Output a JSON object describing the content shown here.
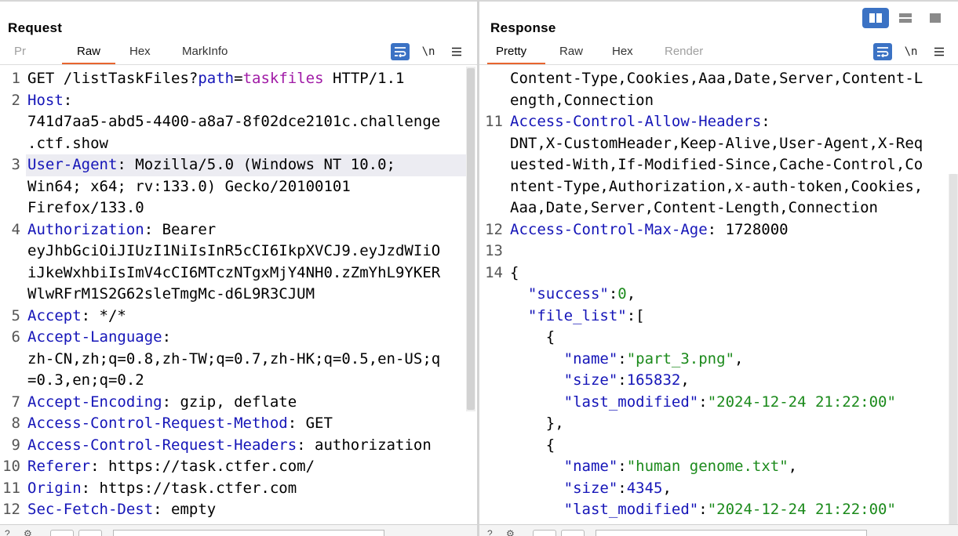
{
  "layout_buttons": [
    {
      "name": "split-vertical-icon",
      "active": true
    },
    {
      "name": "split-horizontal-icon",
      "active": false
    },
    {
      "name": "single-pane-icon",
      "active": false
    }
  ],
  "request": {
    "title": "Request",
    "tabs": [
      "Pr",
      "Raw",
      "Hex",
      "MarkInfo"
    ],
    "active_tab": "Raw",
    "toolbar": {
      "wrap_icon": "wrap-lines-icon",
      "newline_label": "\\n",
      "menu_icon": "menu-icon"
    },
    "lines": [
      {
        "num": "1",
        "parts": [
          [
            "t",
            "GET /listTaskFiles?"
          ],
          [
            "k",
            "path"
          ],
          [
            "t",
            "="
          ],
          [
            "p",
            "taskfiles"
          ],
          [
            "t",
            " HTTP/1.1"
          ]
        ]
      },
      {
        "num": "2",
        "parts": [
          [
            "k",
            "Host"
          ],
          [
            "t",
            ":"
          ]
        ]
      },
      {
        "num": "",
        "parts": [
          [
            "t",
            "741d7aa5-abd5-4400-a8a7-8f02dce2101c.challenge"
          ]
        ]
      },
      {
        "num": "",
        "parts": [
          [
            "t",
            ".ctf.show"
          ]
        ]
      },
      {
        "num": "3",
        "highlight": true,
        "parts": [
          [
            "k",
            "User-Agent"
          ],
          [
            "t",
            ": Mozilla/5.0 (Windows NT 10.0;"
          ]
        ]
      },
      {
        "num": "",
        "parts": [
          [
            "t",
            "Win64; x64; rv:133.0) Gecko/20100101"
          ]
        ]
      },
      {
        "num": "",
        "parts": [
          [
            "t",
            "Firefox/133.0"
          ]
        ]
      },
      {
        "num": "4",
        "parts": [
          [
            "k",
            "Authorization"
          ],
          [
            "t",
            ": Bearer"
          ]
        ]
      },
      {
        "num": "",
        "parts": [
          [
            "t",
            "eyJhbGciOiJIUzI1NiIsInR5cCI6IkpXVCJ9.eyJzdWIiO"
          ]
        ]
      },
      {
        "num": "",
        "parts": [
          [
            "t",
            "iJkeWxhbiIsImV4cCI6MTczNTgxMjY4NH0.zZmYhL9YKER"
          ]
        ]
      },
      {
        "num": "",
        "parts": [
          [
            "t",
            "WlwRFrM1S2G62sleTmgMc-d6L9R3CJUM"
          ]
        ]
      },
      {
        "num": "5",
        "parts": [
          [
            "k",
            "Accept"
          ],
          [
            "t",
            ": */*"
          ]
        ]
      },
      {
        "num": "6",
        "parts": [
          [
            "k",
            "Accept-Language"
          ],
          [
            "t",
            ":"
          ]
        ]
      },
      {
        "num": "",
        "parts": [
          [
            "t",
            "zh-CN,zh;q=0.8,zh-TW;q=0.7,zh-HK;q=0.5,en-US;q"
          ]
        ]
      },
      {
        "num": "",
        "parts": [
          [
            "t",
            "=0.3,en;q=0.2"
          ]
        ]
      },
      {
        "num": "7",
        "parts": [
          [
            "k",
            "Accept-Encoding"
          ],
          [
            "t",
            ": gzip, deflate"
          ]
        ]
      },
      {
        "num": "8",
        "parts": [
          [
            "k",
            "Access-Control-Request-Method"
          ],
          [
            "t",
            ": GET"
          ]
        ]
      },
      {
        "num": "9",
        "parts": [
          [
            "k",
            "Access-Control-Request-Headers"
          ],
          [
            "t",
            ": authorization"
          ]
        ]
      },
      {
        "num": "10",
        "parts": [
          [
            "k",
            "Referer"
          ],
          [
            "t",
            ": https://task.ctfer.com/"
          ]
        ]
      },
      {
        "num": "11",
        "parts": [
          [
            "k",
            "Origin"
          ],
          [
            "t",
            ": https://task.ctfer.com"
          ]
        ]
      },
      {
        "num": "12",
        "parts": [
          [
            "k",
            "Sec-Fetch-Dest"
          ],
          [
            "t",
            ": empty"
          ]
        ]
      }
    ]
  },
  "response": {
    "title": "Response",
    "tabs": [
      "Pretty",
      "Raw",
      "Hex",
      "Render"
    ],
    "active_tab": "Pretty",
    "toolbar": {
      "wrap_icon": "wrap-lines-icon",
      "newline_label": "\\n",
      "menu_icon": "menu-icon"
    },
    "lines": [
      {
        "num": "",
        "parts": [
          [
            "t",
            "Content-Type,Cookies,Aaa,Date,Server,Content-L"
          ]
        ]
      },
      {
        "num": "",
        "parts": [
          [
            "t",
            "ength,Connection"
          ]
        ]
      },
      {
        "num": "11",
        "parts": [
          [
            "k",
            "Access-Control-Allow-Headers"
          ],
          [
            "t",
            ":"
          ]
        ]
      },
      {
        "num": "",
        "parts": [
          [
            "t",
            "DNT,X-CustomHeader,Keep-Alive,User-Agent,X-Req"
          ]
        ]
      },
      {
        "num": "",
        "parts": [
          [
            "t",
            "uested-With,If-Modified-Since,Cache-Control,Co"
          ]
        ]
      },
      {
        "num": "",
        "parts": [
          [
            "t",
            "ntent-Type,Authorization,x-auth-token,Cookies,"
          ]
        ]
      },
      {
        "num": "",
        "parts": [
          [
            "t",
            "Aaa,Date,Server,Content-Length,Connection"
          ]
        ]
      },
      {
        "num": "12",
        "parts": [
          [
            "k",
            "Access-Control-Max-Age"
          ],
          [
            "t",
            ": 1728000"
          ]
        ]
      },
      {
        "num": "13",
        "parts": []
      },
      {
        "num": "14",
        "parts": [
          [
            "t",
            "{"
          ]
        ]
      },
      {
        "num": "",
        "parts": [
          [
            "t",
            "  "
          ],
          [
            "k",
            "\"success\""
          ],
          [
            "t",
            ":"
          ],
          [
            "s",
            "0"
          ],
          [
            "t",
            ","
          ]
        ]
      },
      {
        "num": "",
        "parts": [
          [
            "t",
            "  "
          ],
          [
            "k",
            "\"file_list\""
          ],
          [
            "t",
            ":["
          ]
        ]
      },
      {
        "num": "",
        "parts": [
          [
            "t",
            "    {"
          ]
        ]
      },
      {
        "num": "",
        "parts": [
          [
            "t",
            "      "
          ],
          [
            "k",
            "\"name\""
          ],
          [
            "t",
            ":"
          ],
          [
            "s",
            "\"part_3.png\""
          ],
          [
            "t",
            ","
          ]
        ]
      },
      {
        "num": "",
        "parts": [
          [
            "t",
            "      "
          ],
          [
            "k",
            "\"size\""
          ],
          [
            "t",
            ":"
          ],
          [
            "n",
            "165832"
          ],
          [
            "t",
            ","
          ]
        ]
      },
      {
        "num": "",
        "parts": [
          [
            "t",
            "      "
          ],
          [
            "k",
            "\"last_modified\""
          ],
          [
            "t",
            ":"
          ],
          [
            "s",
            "\"2024-12-24 21:22:00\""
          ]
        ]
      },
      {
        "num": "",
        "parts": [
          [
            "t",
            "    },"
          ]
        ]
      },
      {
        "num": "",
        "parts": [
          [
            "t",
            "    {"
          ]
        ]
      },
      {
        "num": "",
        "parts": [
          [
            "t",
            "      "
          ],
          [
            "k",
            "\"name\""
          ],
          [
            "t",
            ":"
          ],
          [
            "s",
            "\"human genome.txt\""
          ],
          [
            "t",
            ","
          ]
        ]
      },
      {
        "num": "",
        "parts": [
          [
            "t",
            "      "
          ],
          [
            "k",
            "\"size\""
          ],
          [
            "t",
            ":"
          ],
          [
            "n",
            "4345"
          ],
          [
            "t",
            ","
          ]
        ]
      },
      {
        "num": "",
        "parts": [
          [
            "t",
            "      "
          ],
          [
            "k",
            "\"last_modified\""
          ],
          [
            "t",
            ":"
          ],
          [
            "s",
            "\"2024-12-24 21:22:00\""
          ]
        ]
      },
      {
        "num": "",
        "parts": [
          [
            "t",
            "    }"
          ]
        ]
      }
    ]
  }
}
